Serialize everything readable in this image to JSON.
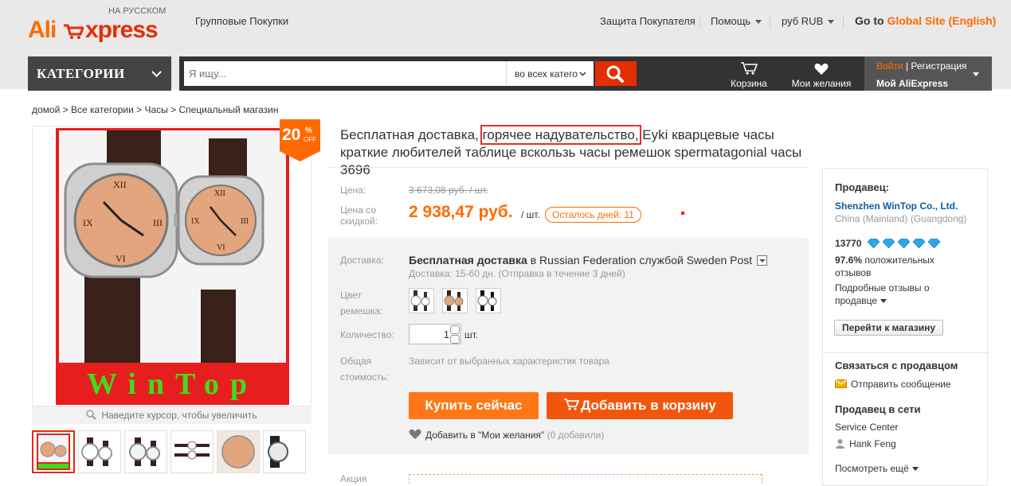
{
  "header": {
    "logo_ali": "Ali",
    "logo_express": "xpress",
    "logo_sub": "НА РУССКОМ",
    "group_buy": "Групповые Покупки",
    "buyer_protection": "Защита Покупателя",
    "help": "Помощь",
    "currency": "руб RUB",
    "goto_prefix": "Go to",
    "goto_link": "Global Site (English)"
  },
  "nav": {
    "categories": "КАТЕГОРИИ",
    "search_placeholder": "Я ищу...",
    "search_scope": "во всех катего",
    "cart": "Корзина",
    "wishlist": "Мои желания",
    "login": "Войти",
    "register": "Регистрация",
    "my_account": "Мой AliExpress"
  },
  "breadcrumb": "домой > Все категории > Часы > Специальный магазин",
  "gallery": {
    "brand_text": "WinTop",
    "discount_num": "20",
    "discount_pct": "%",
    "discount_off": "OFF",
    "zoom_hint": "Наведите курсор, чтобы увеличить"
  },
  "product": {
    "title_a": "Бесплатная доставка,",
    "title_highlight": "горячее надувательство,",
    "title_b": "Eyki кварцевые часы краткие любителей таблице вскользь часы ремешок spermatagonial часы 3696",
    "price_label": "Цена:",
    "old_price": "3 673,08 руб. / шт.",
    "discount_label_1": "Цена со",
    "discount_label_2": "скидкой:",
    "new_price": "2 938,47 руб.",
    "per_unit": "/ шт.",
    "days_left": "Осталось дней: 11"
  },
  "options": {
    "shipping_label": "Доставка:",
    "shipping_free": "Бесплатная доставка",
    "shipping_in": "в",
    "shipping_rest": "Russian Federation службой Sweden Post",
    "shipping_sub": "Доставка: 15-60 дн. (Отправка в течение 3 дней)",
    "color_label_1": "Цвет",
    "color_label_2": "ремешка:",
    "qty_label": "Количество:",
    "qty_value": "1",
    "qty_unit": "шт.",
    "total_label_1": "Общая",
    "total_label_2": "стоимость:",
    "total_text": "Зависит от выбранных характеристик товара",
    "buy_now": "Купить сейчас",
    "add_cart": "Добавить в корзину",
    "wish_text": "Добавить в \"Мои желания\"",
    "wish_count": "(0 добавили)",
    "promo_label": "Акция"
  },
  "seller": {
    "heading": "Продавец:",
    "name": "Shenzhen WinTop Co., Ltd.",
    "location": "China (Mainland) (Guangdong)",
    "score": "13770",
    "positive_pct": "97.6%",
    "positive_text_1": "положительных",
    "positive_text_2": "отзывов",
    "details_1": "Подробные отзывы о",
    "details_2": "продавце",
    "shop_button": "Перейти к магазину",
    "contact_heading": "Связаться с продавцом",
    "send_message": "Отправить сообщение",
    "online_heading": "Продавец в сети",
    "service_center": "Service Center",
    "agent": "Hank Feng",
    "see_more": "Посмотреть ещё"
  },
  "colors": {
    "accent": "#ff6a00",
    "brand_red": "#e62e04",
    "diamond": "#2aa7e8"
  }
}
